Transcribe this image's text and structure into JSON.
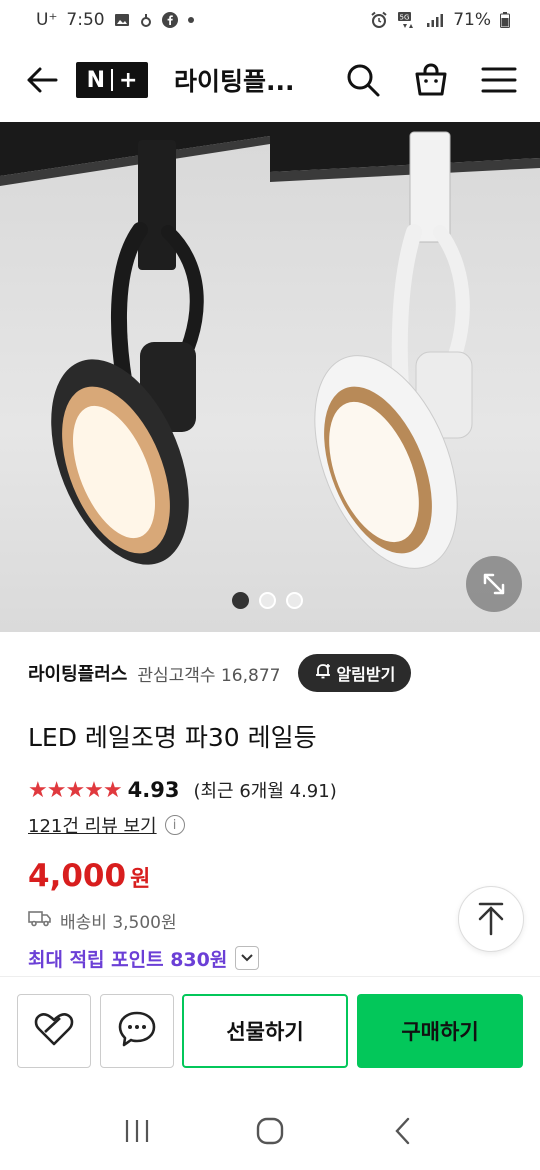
{
  "status_bar": {
    "carrier": "U⁺",
    "time": "7:50",
    "battery": "71%"
  },
  "header": {
    "logo": "N+",
    "store_title": "라이팅플..."
  },
  "gallery": {
    "page_count": 3,
    "active_page": 1
  },
  "store": {
    "name": "라이팅플러스",
    "followers": "관심고객수 16,877",
    "alarm_label": "알림받기"
  },
  "product": {
    "title": "LED 레일조명 파30 레일등",
    "rating": "4.93",
    "rating_stars": 5,
    "recent_rating": "(최근 6개월 4.91)",
    "reviews_link": "121건 리뷰 보기",
    "price": "4,000",
    "currency": "원",
    "shipping": "배송비 3,500원",
    "points": "최대 적립 포인트 830원"
  },
  "actions": {
    "gift_label": "선물하기",
    "buy_label": "구매하기"
  },
  "colors": {
    "price": "#d81e1e",
    "points": "#6b3fd6",
    "brand_green": "#03c75a",
    "stars": "#e0393e"
  }
}
